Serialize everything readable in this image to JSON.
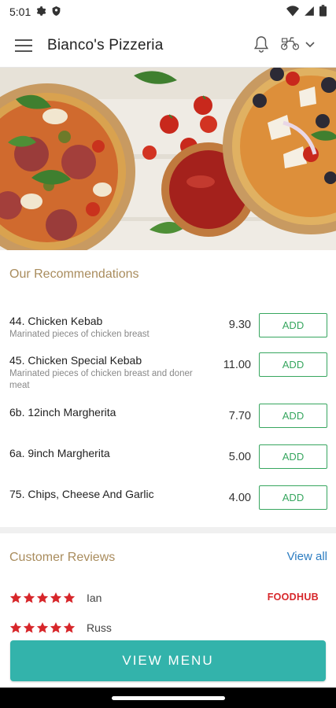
{
  "status_bar": {
    "time": "5:01"
  },
  "header": {
    "title": "Bianco's Pizzeria"
  },
  "recommendations": {
    "title": "Our Recommendations",
    "items": [
      {
        "name": "44. Chicken Kebab",
        "description": "Marinated pieces of chicken breast",
        "price": "9.30",
        "button": "ADD"
      },
      {
        "name": "45. Chicken Special Kebab",
        "description": "Marinated pieces of chicken breast and doner meat",
        "price": "11.00",
        "button": "ADD"
      },
      {
        "name": "6b. 12inch Margherita",
        "description": "",
        "price": "7.70",
        "button": "ADD"
      },
      {
        "name": "6a. 9inch Margherita",
        "description": "",
        "price": "5.00",
        "button": "ADD"
      },
      {
        "name": "75. Chips, Cheese And Garlic",
        "description": "",
        "price": "4.00",
        "button": "ADD"
      }
    ]
  },
  "reviews": {
    "title": "Customer Reviews",
    "view_all": "View all",
    "source_brand": "FOODHUB",
    "entries": [
      {
        "reviewer": "Ian",
        "stars": 5
      },
      {
        "reviewer": "Russ",
        "stars": 5
      }
    ]
  },
  "footer": {
    "view_menu": "VIEW MENU"
  },
  "colors": {
    "accent_gold": "#a98c5d",
    "add_green": "#37a65f",
    "link_blue": "#2b7cc1",
    "star_red": "#d7262a",
    "button_teal": "#33b3ab"
  }
}
